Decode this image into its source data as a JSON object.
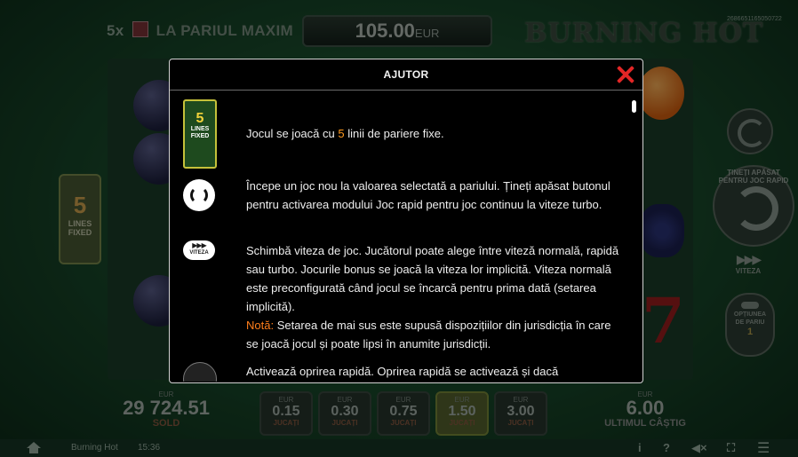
{
  "top": {
    "maxbet_multiplier": "5x",
    "maxbet_label": "LA PARIUL MAXIM",
    "win_amount": "105.00",
    "win_currency": "EUR",
    "logo": "BURNING HOT",
    "serial": "2686651165050722"
  },
  "left_lines": {
    "number": "5",
    "line1": "LINES",
    "line2": "FIXED"
  },
  "right_controls": {
    "spin_ring_text": "ȚINEȚI APĂSAT PENTRU JOC RAPID",
    "speed_label": "VITEZA",
    "speed_arrows": "▶▶▶",
    "options_label1": "OPȚIUNEA",
    "options_label2": "DE PARIU",
    "options_value": "1"
  },
  "bottom": {
    "balance_currency": "EUR",
    "balance_amount": "29 724.51",
    "balance_label": "SOLD",
    "bets": [
      {
        "currency": "EUR",
        "value": "0.15",
        "label": "JUCAȚI"
      },
      {
        "currency": "EUR",
        "value": "0.30",
        "label": "JUCAȚI"
      },
      {
        "currency": "EUR",
        "value": "0.75",
        "label": "JUCAȚI"
      },
      {
        "currency": "EUR",
        "value": "1.50",
        "label": "JUCAȚI"
      },
      {
        "currency": "EUR",
        "value": "3.00",
        "label": "JUCAȚI"
      }
    ],
    "selected_bet_index": 3,
    "lastwin_currency": "EUR",
    "lastwin_amount": "6.00",
    "lastwin_label": "ULTIMUL CÂȘTIG"
  },
  "statusbar": {
    "game_name": "Burning Hot",
    "time": "15:36",
    "info_glyph": "i",
    "help_glyph": "?",
    "mute_glyph": "◀×",
    "fullscreen_glyph": "⛶",
    "menu_glyph": "☰"
  },
  "help_modal": {
    "title": "AJUTOR",
    "lines_icon": {
      "number": "5",
      "line1": "LINES",
      "line2": "FIXED"
    },
    "speed_icon": {
      "arrows": "▶▶▶",
      "label": "VITEZA"
    },
    "row1_pre": "Jocul se joacă cu ",
    "row1_highlight": "5",
    "row1_post": " linii de pariere fixe.",
    "row2": "Începe un joc nou la valoarea selectată a pariului. Țineți apăsat butonul pentru activarea modului Joc rapid pentru joc continuu la viteze turbo.",
    "row3": "Schimbă viteza de joc. Jucătorul poate alege între viteză normală, rapidă sau turbo. Jocurile bonus se joacă la viteza lor implicită. Viteza normală este preconfigurată când jocul se încarcă pentru prima dată (setarea implicită).",
    "row3_note_label": "Notă:",
    "row3_note_text": " Setarea de mai sus este supusă dispozițiilor din jurisdicția în care se joacă jocul și poate lipsi în anumite jurisdicții.",
    "row4_partial": "Activează oprirea rapidă. Oprirea rapidă se activează și dacă"
  }
}
